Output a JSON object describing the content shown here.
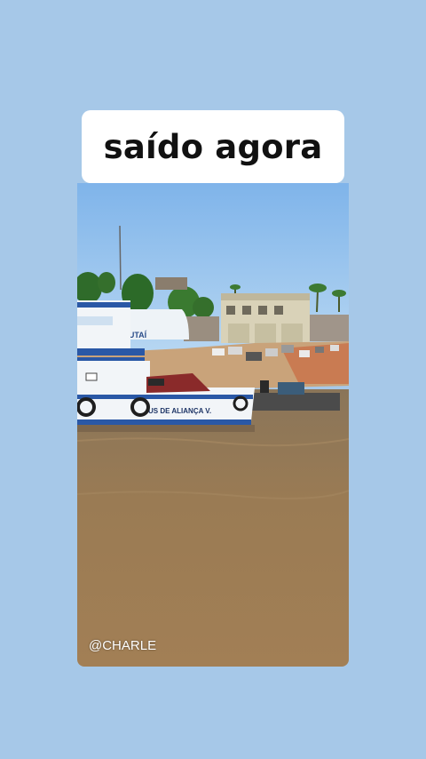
{
  "story": {
    "caption": "saído agora",
    "watermark": "@CHARLE"
  },
  "scene": {
    "boat_name": "TO JUTAÍ",
    "boat_hull_text": "US DE ALIANÇA V."
  },
  "colors": {
    "background": "#a6c8e8",
    "caption_bg": "#ffffff",
    "caption_text": "#111111",
    "sky": "#8fc0ee",
    "river": "#9a7a55"
  }
}
